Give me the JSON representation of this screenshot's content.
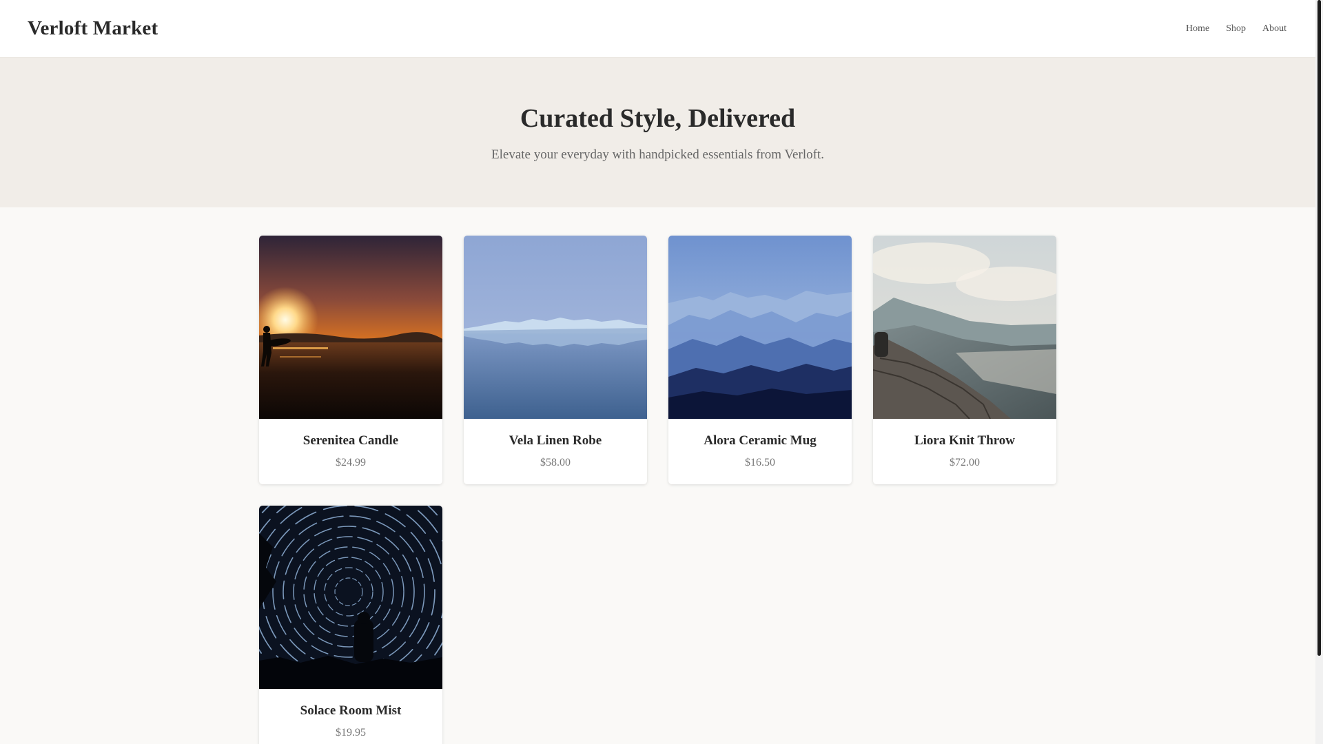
{
  "header": {
    "brand": "Verloft Market",
    "nav": [
      "Home",
      "Shop",
      "About"
    ]
  },
  "hero": {
    "title": "Curated Style, Delivered",
    "subtitle": "Elevate your everyday with handpicked essentials from Verloft."
  },
  "products": [
    {
      "name": "Serenitea Candle",
      "price": "$24.99",
      "image": "sunset-surfer-photo"
    },
    {
      "name": "Vela Linen Robe",
      "price": "$58.00",
      "image": "glacier-lake-photo"
    },
    {
      "name": "Alora Ceramic Mug",
      "price": "$16.50",
      "image": "misty-mountains-photo"
    },
    {
      "name": "Liora Knit Throw",
      "price": "$72.00",
      "image": "mountain-valley-wall-photo"
    },
    {
      "name": "Solace Room Mist",
      "price": "$19.95",
      "image": "star-trails-photo"
    }
  ],
  "colors": {
    "header_bg": "#ffffff",
    "hero_bg": "#f1ede8",
    "page_bg": "#faf9f7",
    "text_dark": "#2a2a2a",
    "text_muted": "#777777"
  }
}
